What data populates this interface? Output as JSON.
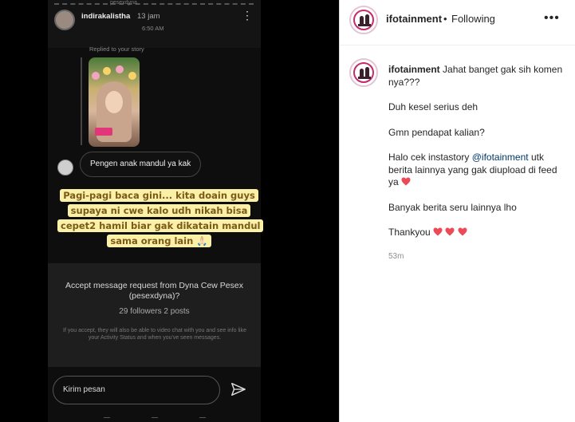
{
  "story": {
    "top_handle": "pesexdyna",
    "username": "indirakalistha",
    "age": "13 jam",
    "clock": "6:50 AM",
    "replied_label": "Replied to your story",
    "message": "Pengen anak mandul ya kak",
    "caption": "Pagi-pagi baca gini... kita doain guys supaya ni cwe kalo udh nikah bisa cepet2 hamil biar gak dikatain mandul sama orang lain 🙏🏻"
  },
  "request": {
    "title": "Accept message request from Dyna Cew Pesex (pesexdyna)?",
    "stats": "29 followers 2 posts",
    "note": "If you accept, they will also be able to video chat with you and see info like your Activity Status and when you've seen messages."
  },
  "composer": {
    "placeholder": "Kirim pesan"
  },
  "header": {
    "username": "ifotainment",
    "separator": "•",
    "follow_status": "Following",
    "more": "•••"
  },
  "post": {
    "username": "ifotainment",
    "lines": [
      "Jahat banget gak sih komen nya???",
      "Duh kesel serius deh",
      "Gmn pendapat kalian?",
      "Halo cek instastory",
      "@ifotainment",
      "utk berita lainnya yang gak diupload di feed ya",
      "Banyak berita seru lainnya lho",
      "Thankyou"
    ],
    "time": "53m"
  },
  "colors": {
    "heart": "#ed4956",
    "mention": "#00376b",
    "caption_bg": "#fbf0a8",
    "caption_text": "#7a5a18"
  }
}
